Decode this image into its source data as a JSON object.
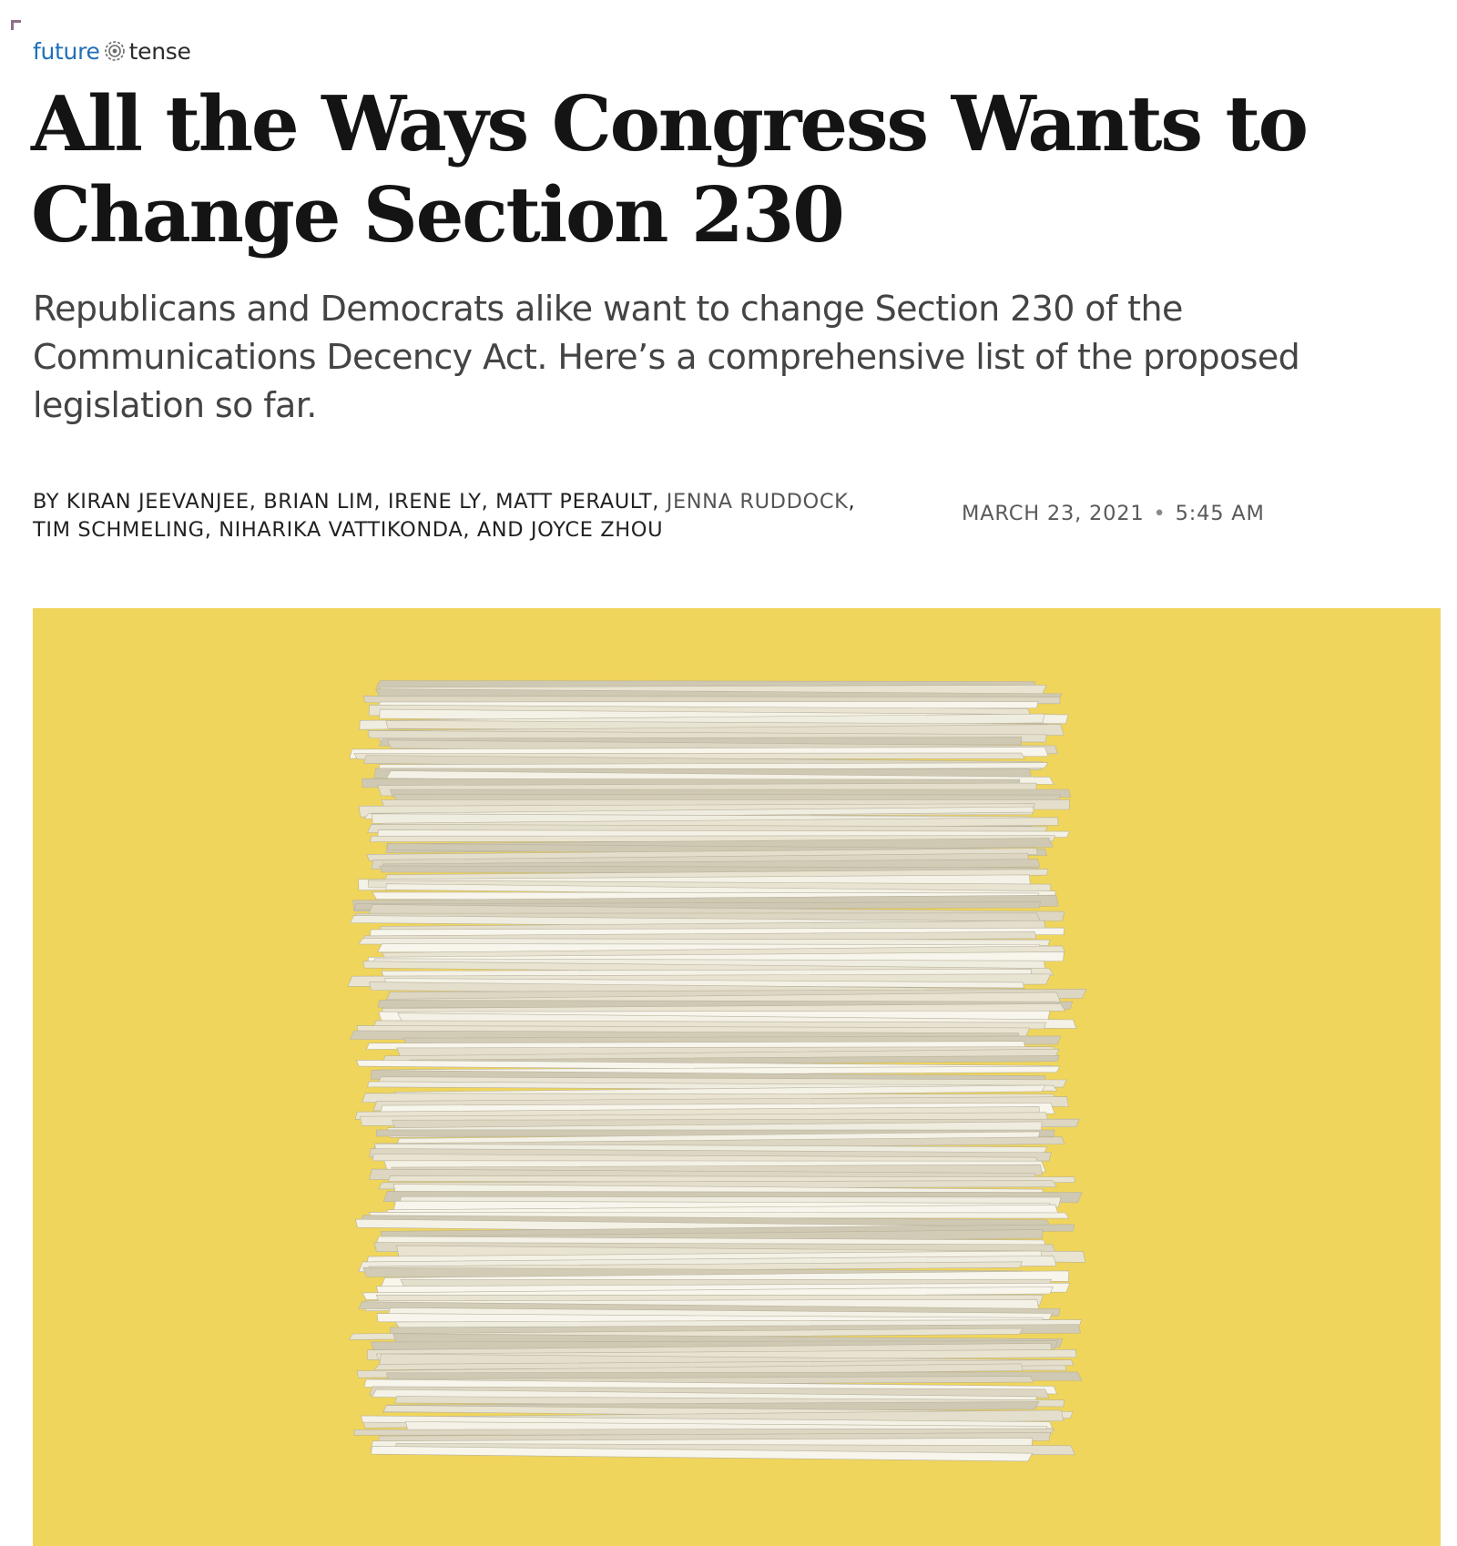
{
  "kicker": {
    "part1": "future",
    "part2": "tense",
    "icon": "future-tense-logo-icon"
  },
  "headline": {
    "line1": "All the Ways Congress Wants to",
    "line2": "Change Section 230"
  },
  "dek": {
    "line1": "Republicans and Democrats alike want to change Section 230 of the",
    "line2": "Communications Decency Act. Here’s a comprehensive list of the proposed",
    "line3": "legislation so far."
  },
  "byline": {
    "prefix": "By ",
    "authors": [
      {
        "name": "Kiran Jeevanjee",
        "linked": false,
        "sep": ", "
      },
      {
        "name": "Brian Lim",
        "linked": false,
        "sep": ", "
      },
      {
        "name": "Irene Ly",
        "linked": false,
        "sep": ", "
      },
      {
        "name": "Matt Perault",
        "linked": false,
        "sep": ", "
      },
      {
        "name": "Jenna Ruddock",
        "linked": true,
        "sep": ", "
      },
      {
        "name": "Tim Schmeling",
        "linked": false,
        "sep": ", "
      },
      {
        "name": "Niharika Vattikonda",
        "linked": false,
        "sep": ", and "
      },
      {
        "name": "Joyce Zhou",
        "linked": false,
        "sep": ""
      }
    ]
  },
  "dateline": {
    "date": "March 23, 2021",
    "separator": "•",
    "time": "5:45 AM"
  },
  "hero": {
    "description_icon": "paper-stack-illustration",
    "background_color": "#efd55c",
    "paper_color": "#eeeadc"
  },
  "colors": {
    "kicker_blue": "#1f6fb8",
    "corner_mark": "#8f6f86",
    "headline": "#141414",
    "dek": "#444444"
  }
}
